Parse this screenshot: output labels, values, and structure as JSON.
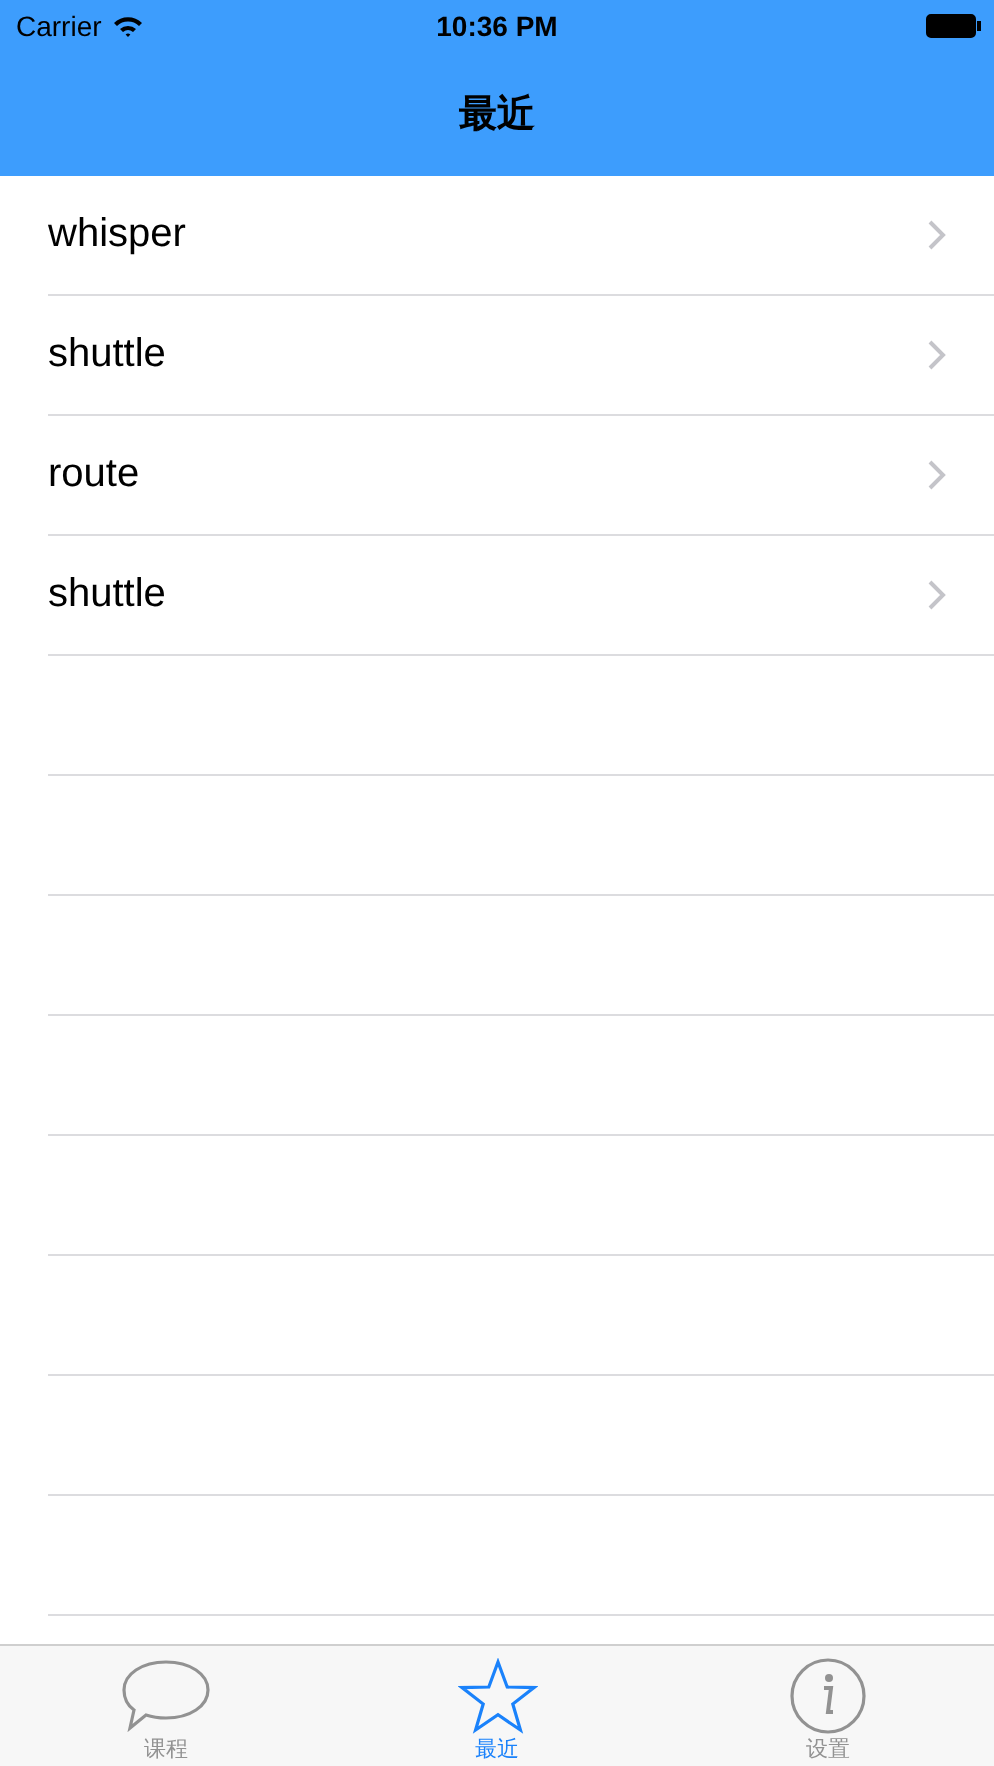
{
  "status_bar": {
    "carrier": "Carrier",
    "time": "10:36 PM"
  },
  "nav_bar": {
    "title": "最近"
  },
  "rows": [
    {
      "label": "whisper"
    },
    {
      "label": "shuttle"
    },
    {
      "label": "route"
    },
    {
      "label": "shuttle"
    }
  ],
  "tab_bar": [
    {
      "label": "课程",
      "selected": false
    },
    {
      "label": "最近",
      "selected": true
    },
    {
      "label": "设置",
      "selected": false
    }
  ]
}
